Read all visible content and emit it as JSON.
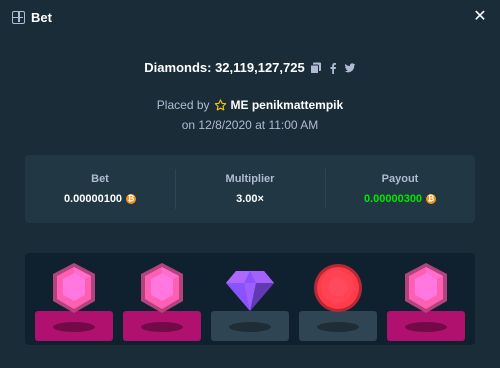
{
  "header": {
    "title": "Bet",
    "icon": "bet-slip-icon",
    "close_icon": "close-icon",
    "close_glyph": "✕"
  },
  "summary": {
    "diamonds_label": "Diamonds: 32,119,127,725",
    "icons": [
      "copy-icon",
      "facebook-icon",
      "twitter-icon"
    ]
  },
  "placed": {
    "prefix": "Placed by",
    "user": "ME penikmattempik",
    "user_icon": "star-icon",
    "date": "on 12/8/2020 at 11:00 AM"
  },
  "stats": [
    {
      "label": "Bet",
      "value": "0.00000100",
      "currency_icon": "btc-coin-icon"
    },
    {
      "label": "Multiplier",
      "value": "3.00×"
    },
    {
      "label": "Payout",
      "value": "0.00000300",
      "currency_icon": "btc-coin-icon",
      "color": "#00e701"
    }
  ],
  "gems": [
    {
      "name": "pink-gem",
      "color": "#ff5fb2",
      "active": true
    },
    {
      "name": "pink-gem",
      "color": "#ff5fb2",
      "active": true
    },
    {
      "name": "purple-gem",
      "color": "#8b52ff",
      "active": false
    },
    {
      "name": "red-gem",
      "color": "#ff3b4a",
      "active": false
    },
    {
      "name": "pink-gem",
      "color": "#ff5fb2",
      "active": true
    }
  ],
  "colors": {
    "background": "#1a2c38",
    "panel": "#213743",
    "board": "#0f212e",
    "active_base": "#b0106e",
    "inactive_base": "#2f4553",
    "payout_green": "#00e701"
  }
}
